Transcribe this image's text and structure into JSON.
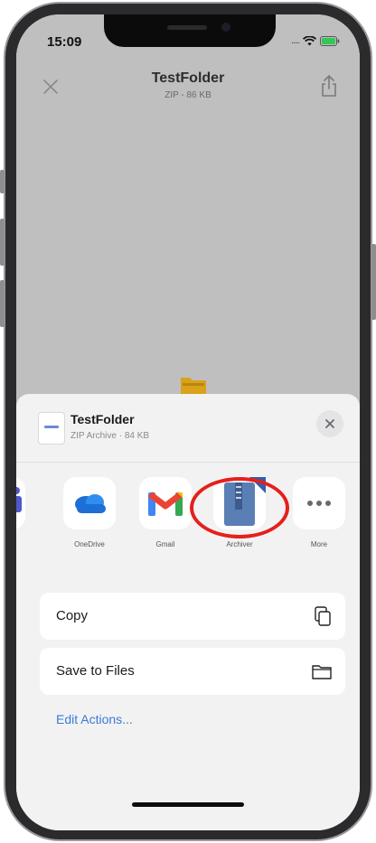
{
  "status_bar": {
    "time": "15:09",
    "signal": "....."
  },
  "nav": {
    "title": "TestFolder",
    "subtitle": "ZIP - 86 KB"
  },
  "share_sheet": {
    "file_name": "TestFolder",
    "file_info": "ZIP Archive · 84 KB",
    "apps": [
      {
        "label": "",
        "icon": "teams-icon"
      },
      {
        "label": "OneDrive",
        "icon": "onedrive-icon"
      },
      {
        "label": "Gmail",
        "icon": "gmail-icon"
      },
      {
        "label": "Archiver",
        "icon": "archiver-icon"
      },
      {
        "label": "More",
        "icon": "more-icon"
      }
    ],
    "actions": [
      {
        "label": "Copy",
        "icon": "copy-icon"
      },
      {
        "label": "Save to Files",
        "icon": "folder-icon"
      }
    ],
    "edit_actions_label": "Edit Actions..."
  },
  "colors": {
    "highlight": "#e5201d",
    "link": "#3a7bd5",
    "onedrive": "#1d6fd6"
  }
}
